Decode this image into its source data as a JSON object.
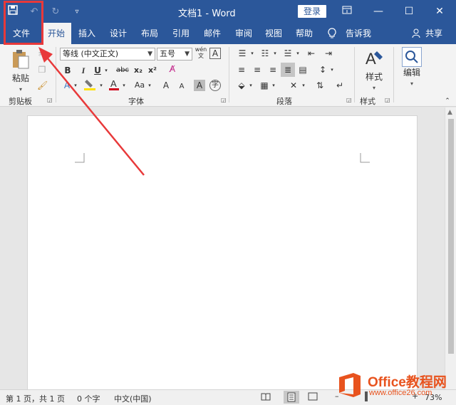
{
  "titlebar": {
    "doc_title": "文档1  -  Word",
    "login_label": "登录",
    "qat": [
      "save-icon",
      "undo-icon",
      "redo-icon",
      "customize-qat-icon"
    ]
  },
  "tabs": [
    {
      "label": "文件"
    },
    {
      "label": "开始"
    },
    {
      "label": "插入"
    },
    {
      "label": "设计"
    },
    {
      "label": "布局"
    },
    {
      "label": "引用"
    },
    {
      "label": "邮件"
    },
    {
      "label": "审阅"
    },
    {
      "label": "视图"
    },
    {
      "label": "帮助"
    },
    {
      "label": "告诉我"
    }
  ],
  "share_label": "共享",
  "ribbon": {
    "clipboard": {
      "paste_label": "粘贴",
      "group_label": "剪贴板"
    },
    "font": {
      "font_name": "等线 (中文正文)",
      "font_size": "五号",
      "phonetic": "wén\n文",
      "group_label": "字体",
      "bold": "B",
      "italic": "I",
      "underline": "U",
      "strike": "abc",
      "subscript": "x₂",
      "superscript": "x²",
      "grow": "A",
      "shrink": "A",
      "change_case": "Aa"
    },
    "paragraph": {
      "group_label": "段落"
    },
    "styles": {
      "label": "样式",
      "group_label": "样式"
    },
    "editing": {
      "label": "编辑"
    }
  },
  "statusbar": {
    "page": "第 1 页，共 1 页",
    "words": "0 个字",
    "language": "中文(中国)",
    "zoom": "73%"
  },
  "watermark": {
    "text1": "Office教程网",
    "text2": "www.office26.com"
  },
  "colors": {
    "brand": "#2b579a",
    "annotation": "#e8393a",
    "font_color": "#d0021b",
    "highlight_color": "#ffe100"
  }
}
